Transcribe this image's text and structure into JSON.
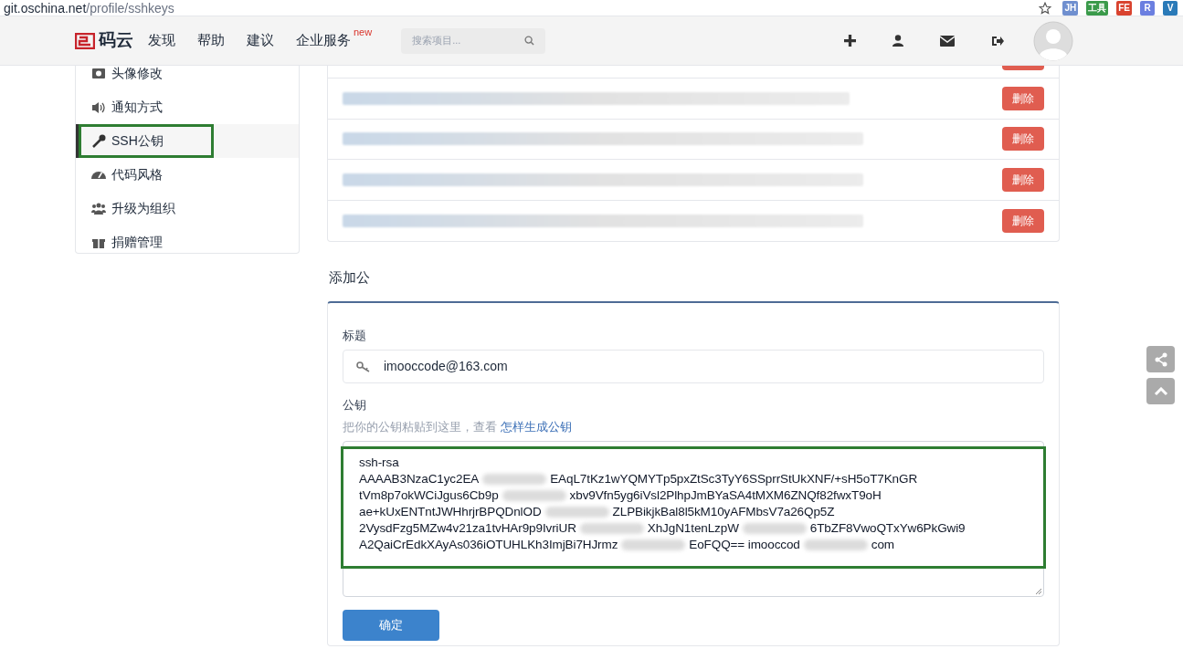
{
  "address_bar": {
    "host": "git.oschina.net",
    "path": "/profile/sshkeys"
  },
  "extensions": [
    {
      "label": "JH",
      "color": "#6f8fcf"
    },
    {
      "label": "工具",
      "color": "#3a9a4a"
    },
    {
      "label": "FE",
      "color": "#d9432f"
    },
    {
      "label": "R",
      "color": "#6b7fe0"
    },
    {
      "label": "V",
      "color": "#2a7ab8"
    }
  ],
  "nav": {
    "logo": "码云",
    "links": [
      {
        "label": "发现"
      },
      {
        "label": "帮助"
      },
      {
        "label": "建议"
      },
      {
        "label": "企业服务",
        "badge": "new"
      }
    ],
    "search": {
      "placeholder": "搜索项目..."
    }
  },
  "sidebar": {
    "items": [
      {
        "label": "头像修改",
        "kind": "image",
        "selected": false
      },
      {
        "label": "通知方式",
        "kind": "sound",
        "selected": false
      },
      {
        "label": "SSH公钥",
        "kind": "key",
        "selected": true,
        "highlighted": true
      },
      {
        "label": "代码风格",
        "kind": "gauge",
        "selected": false
      },
      {
        "label": "升级为组织",
        "kind": "users",
        "selected": false
      },
      {
        "label": "捐赠管理",
        "kind": "gift",
        "selected": false
      }
    ]
  },
  "keys": {
    "rows": [
      {
        "delete": "删除"
      },
      {
        "delete": "删除"
      },
      {
        "delete": "删除"
      },
      {
        "delete": "删除"
      }
    ]
  },
  "form": {
    "section_title": "添加公",
    "title_label": "标题",
    "title_value": "imooccode@163.com",
    "key_label": "公钥",
    "hint": "把你的公钥粘贴到这里，查看",
    "hint_link": "怎样生成公钥",
    "key_lines": [
      [
        "ssh-rsa"
      ],
      [
        "AAAAB3NzaC1yc2EA",
        "EAqL7tKz1wYQMYTp5pxZtSc3TyY6SSprrStUkXNF/+sH5oT7KnGR"
      ],
      [
        "tVm8p7okWCiJgus6Cb9p",
        "xbv9Vfn5yg6iVsl2PlhpJmBYaSA4tMXM6ZNQf82fwxT9oH"
      ],
      [
        "ae+kUxENTntJWHhrjrBPQDnlOD",
        "ZLPBikjkBal8l5kM10yAFMbsV7a26Qp5Z"
      ],
      [
        "2VysdFzg5MZw4v21za1tvHAr9p9IvriUR",
        "XhJgN1tenLzpW",
        "6TbZF8VwoQTxYw6PkGwi9"
      ],
      [
        "A2QaiCrEdkXAyAs036iOTUHLKh3ImjBi7HJrmz",
        "EoFQQ== imooccod",
        "com"
      ]
    ],
    "key_highlighted": true,
    "submit": "确定"
  }
}
